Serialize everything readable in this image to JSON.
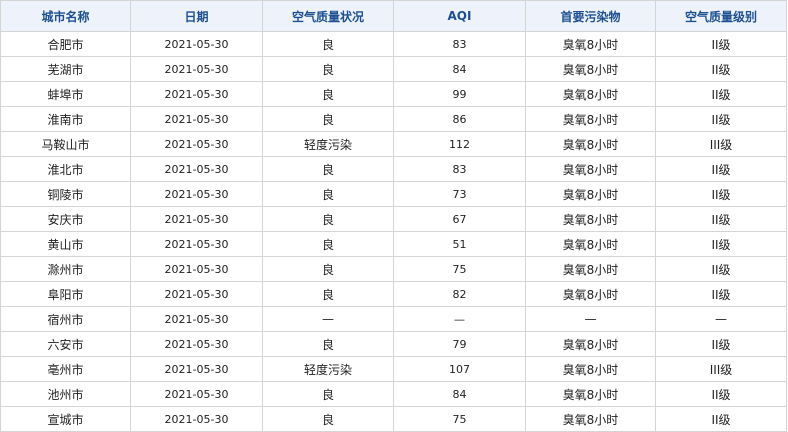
{
  "table": {
    "headers": [
      "城市名称",
      "日期",
      "空气质量状况",
      "AQI",
      "首要污染物",
      "空气质量级别"
    ],
    "rows": [
      {
        "city": "合肥市",
        "date": "2021-05-30",
        "status": "良",
        "aqi": "83",
        "pollutant": "臭氧8小时",
        "level": "II级"
      },
      {
        "city": "芜湖市",
        "date": "2021-05-30",
        "status": "良",
        "aqi": "84",
        "pollutant": "臭氧8小时",
        "level": "II级"
      },
      {
        "city": "蚌埠市",
        "date": "2021-05-30",
        "status": "良",
        "aqi": "99",
        "pollutant": "臭氧8小时",
        "level": "II级"
      },
      {
        "city": "淮南市",
        "date": "2021-05-30",
        "status": "良",
        "aqi": "86",
        "pollutant": "臭氧8小时",
        "level": "II级"
      },
      {
        "city": "马鞍山市",
        "date": "2021-05-30",
        "status": "轻度污染",
        "aqi": "112",
        "pollutant": "臭氧8小时",
        "level": "III级"
      },
      {
        "city": "淮北市",
        "date": "2021-05-30",
        "status": "良",
        "aqi": "83",
        "pollutant": "臭氧8小时",
        "level": "II级"
      },
      {
        "city": "铜陵市",
        "date": "2021-05-30",
        "status": "良",
        "aqi": "73",
        "pollutant": "臭氧8小时",
        "level": "II级"
      },
      {
        "city": "安庆市",
        "date": "2021-05-30",
        "status": "良",
        "aqi": "67",
        "pollutant": "臭氧8小时",
        "level": "II级"
      },
      {
        "city": "黄山市",
        "date": "2021-05-30",
        "status": "良",
        "aqi": "51",
        "pollutant": "臭氧8小时",
        "level": "II级"
      },
      {
        "city": "滁州市",
        "date": "2021-05-30",
        "status": "良",
        "aqi": "75",
        "pollutant": "臭氧8小时",
        "level": "II级"
      },
      {
        "city": "阜阳市",
        "date": "2021-05-30",
        "status": "良",
        "aqi": "82",
        "pollutant": "臭氧8小时",
        "level": "II级"
      },
      {
        "city": "宿州市",
        "date": "2021-05-30",
        "status": "—",
        "aqi": "—",
        "pollutant": "—",
        "level": "—"
      },
      {
        "city": "六安市",
        "date": "2021-05-30",
        "status": "良",
        "aqi": "79",
        "pollutant": "臭氧8小时",
        "level": "II级"
      },
      {
        "city": "亳州市",
        "date": "2021-05-30",
        "status": "轻度污染",
        "aqi": "107",
        "pollutant": "臭氧8小时",
        "level": "III级"
      },
      {
        "city": "池州市",
        "date": "2021-05-30",
        "status": "良",
        "aqi": "84",
        "pollutant": "臭氧8小时",
        "level": "II级"
      },
      {
        "city": "宣城市",
        "date": "2021-05-30",
        "status": "良",
        "aqi": "75",
        "pollutant": "臭氧8小时",
        "level": "II级"
      }
    ]
  }
}
